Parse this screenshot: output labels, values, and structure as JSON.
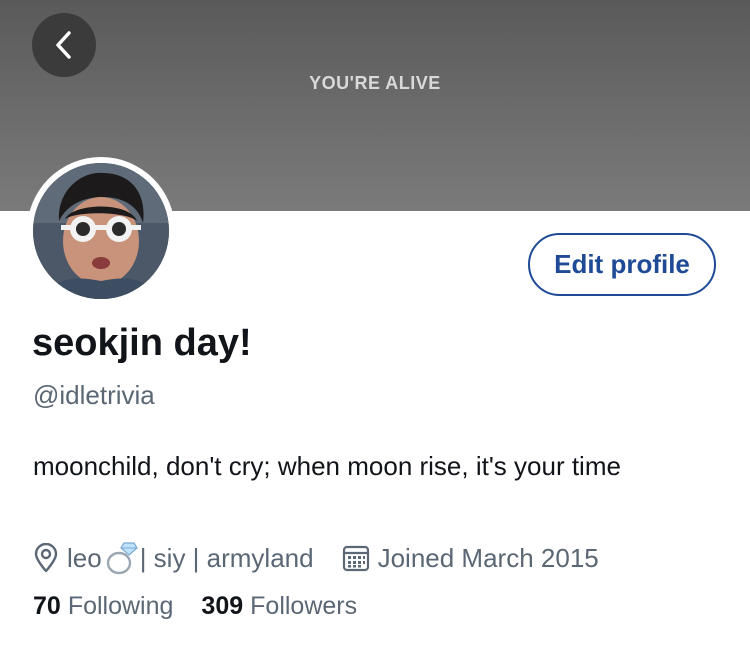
{
  "banner": {
    "text": "YOU'RE ALIVE"
  },
  "profile": {
    "edit_button": "Edit profile",
    "display_name": "seokjin day!",
    "handle": "@idletrivia",
    "bio": "moonchild, don't cry; when moon rise, it's your time",
    "location": "leo",
    "location_suffix": "| siy | armyland",
    "joined": "Joined March 2015"
  },
  "stats": {
    "following_count": "70",
    "following_label": "Following",
    "followers_count": "309",
    "followers_label": "Followers"
  },
  "colors": {
    "accent": "#1f4a96",
    "text_primary": "#111418",
    "text_secondary": "#5b6774",
    "banner": "#6c6c6c"
  },
  "icons": [
    "back-icon",
    "location-icon",
    "ring-icon",
    "calendar-icon"
  ]
}
